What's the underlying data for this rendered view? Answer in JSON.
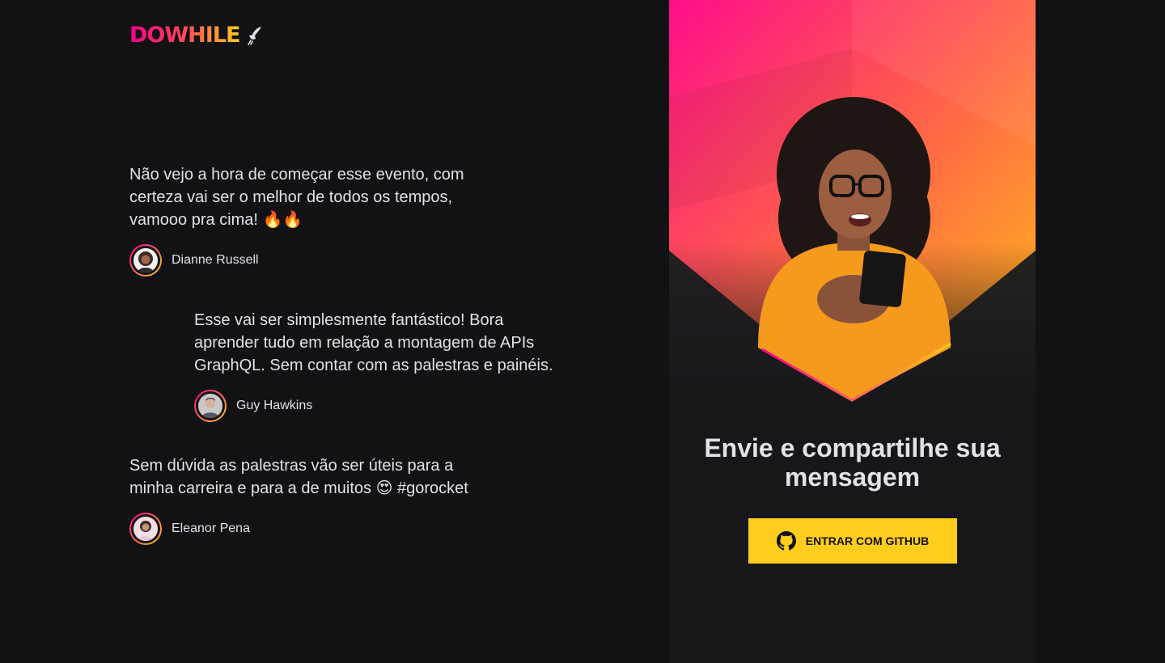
{
  "logo": {
    "text": "DOWHILE",
    "icon": "rocket-icon"
  },
  "messages": [
    {
      "text": "Não vejo a hora de começar esse evento, com certeza vai ser o melhor de todos os tempos, vamooo pra cima! 🔥🔥",
      "author": "Dianne Russell"
    },
    {
      "text": "Esse vai ser simplesmente fantástico! Bora aprender tudo em relação a montagem de APIs GraphQL. Sem contar com as palestras e painéis.",
      "author": "Guy Hawkins"
    },
    {
      "text": "Sem dúvida as palestras vão ser úteis para a minha carreira e para a de muitos 😍 #gorocket",
      "author": "Eleanor Pena"
    }
  ],
  "panel": {
    "title": "Envie e compartilhe sua mensagem",
    "button_label": "ENTRAR COM GITHUB",
    "button_icon": "github-icon"
  },
  "colors": {
    "background": "#121214",
    "panel": "#17171a",
    "accent_pink": "#ff008e",
    "accent_yellow": "#ffcd1e",
    "text": "#e1e1e6"
  }
}
